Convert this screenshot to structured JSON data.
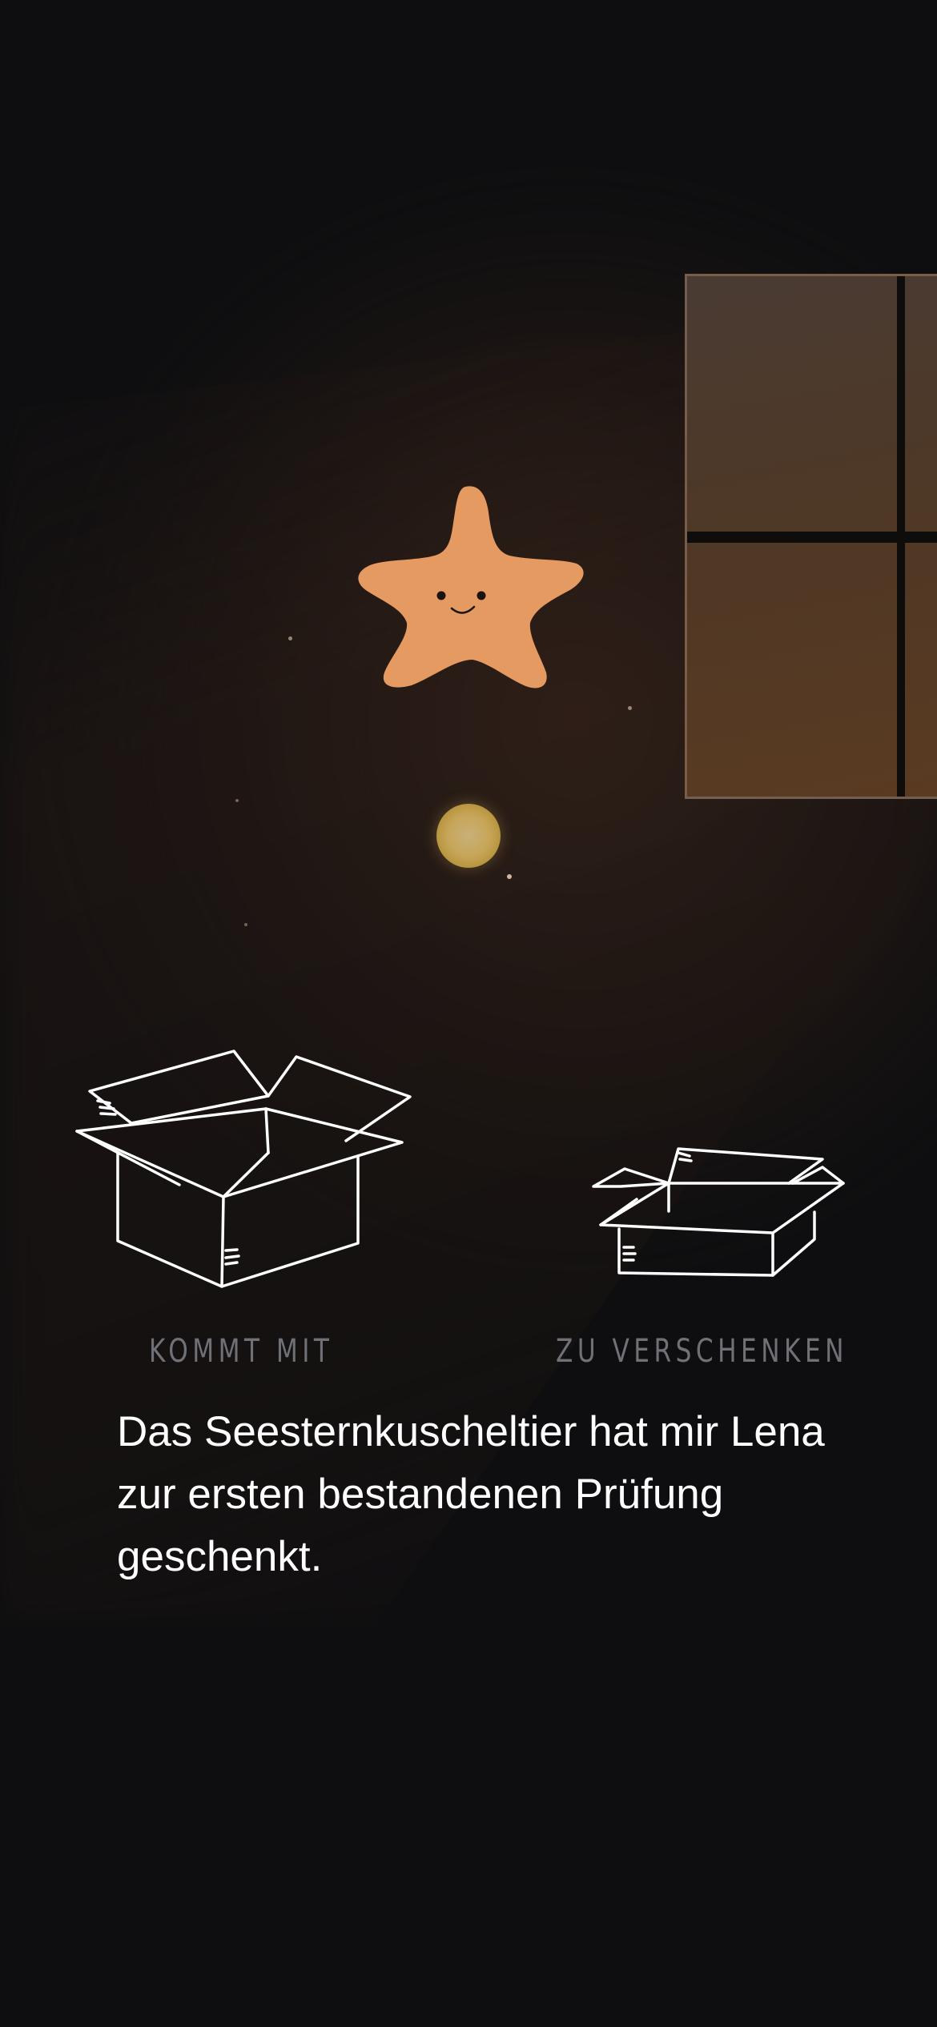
{
  "scene": {
    "window": "window-icon",
    "star": "starfish-plush-icon",
    "orb": "glowing-orb-icon"
  },
  "boxes": {
    "keep": {
      "icon": "open-box-large-icon",
      "label": "KOMMT MIT"
    },
    "give_away": {
      "icon": "open-box-small-icon",
      "label": "ZU VERSCHENKEN"
    }
  },
  "caption": {
    "text": "Das Seesternkuscheltier hat mir Lena zur ersten bestandenen Prüfung geschenkt."
  },
  "colors": {
    "background": "#0e0e10",
    "starfish": "#e59a62",
    "orb": "#c7a659",
    "label": "#6f7176",
    "caption": "#ffffff"
  }
}
